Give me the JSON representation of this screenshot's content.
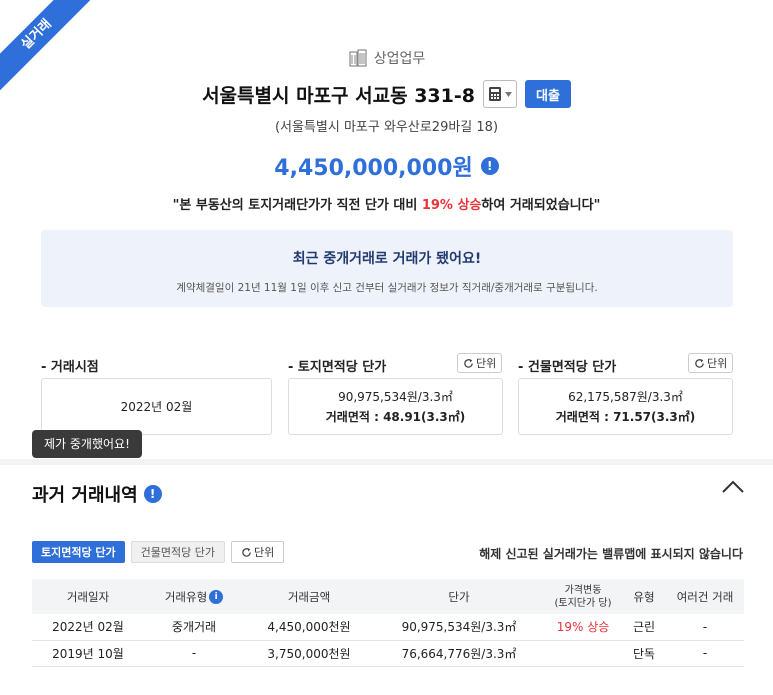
{
  "ribbon": "실거래",
  "header": {
    "category": "상업업무",
    "address": "서울특별시 마포구 서교동 331-8",
    "loan_label": "대출",
    "road_address": "(서울특별시 마포구 와우산로29바길 18)",
    "price": "4,450,000,000원"
  },
  "trend": {
    "prefix": "\"본 부동산의 토지거래단가가 직전 단가 대비",
    "change": "19% 상승",
    "suffix": "하여 거래되었습니다\""
  },
  "notice": {
    "title": "최근 중개거래로 거래가 됐어요!",
    "desc": "계약체결일이 21년 11월 1일 이후 신고 건부터 실거래가 정보가 직거래/중개거래로 구분됩니다."
  },
  "metrics": {
    "unit_label": "단위",
    "deal_date": {
      "label": "- 거래시점",
      "value": "2022년 02월"
    },
    "land": {
      "label": "- 토지면적당 단가",
      "price": "90,975,534원/3.3㎡",
      "area": "거래면적 : 48.91(3.3㎡)"
    },
    "building": {
      "label": "- 건물면적당 단가",
      "price": "62,175,587원/3.3㎡",
      "area": "거래면적 : 71.57(3.3㎡)"
    }
  },
  "tooltip": "제가 중개했어요!",
  "history": {
    "title": "과거 거래내역",
    "filters": {
      "land": "토지면적당 단가",
      "building": "건물면적당 단가",
      "unit": "단위"
    },
    "note": "해제 신고된 실거래가는 밸류맵에 표시되지 않습니다",
    "columns": {
      "date": "거래일자",
      "type": "거래유형",
      "amount": "거래금액",
      "unit_price": "단가",
      "change_line1": "가격변동",
      "change_line2": "(토지단가 당)",
      "kind": "유형",
      "multi": "여러건 거래"
    },
    "rows": [
      {
        "date": "2022년 02월",
        "type": "중개거래",
        "amount": "4,450,000천원",
        "unit_price": "90,975,534원/3.3㎡",
        "change": "19% 상승",
        "kind": "근린",
        "multi": "-"
      },
      {
        "date": "2019년 10월",
        "type": "-",
        "amount": "3,750,000천원",
        "unit_price": "76,664,776원/3.3㎡",
        "change": "",
        "kind": "단독",
        "multi": "-"
      }
    ]
  },
  "colors": {
    "accent": "#2f6fd9",
    "up": "#e8333a",
    "notice_bg": "#eef2fb"
  },
  "icons": [
    "building-icon",
    "calculator-icon",
    "info-icon",
    "refresh-icon",
    "chevron-up-icon"
  ]
}
